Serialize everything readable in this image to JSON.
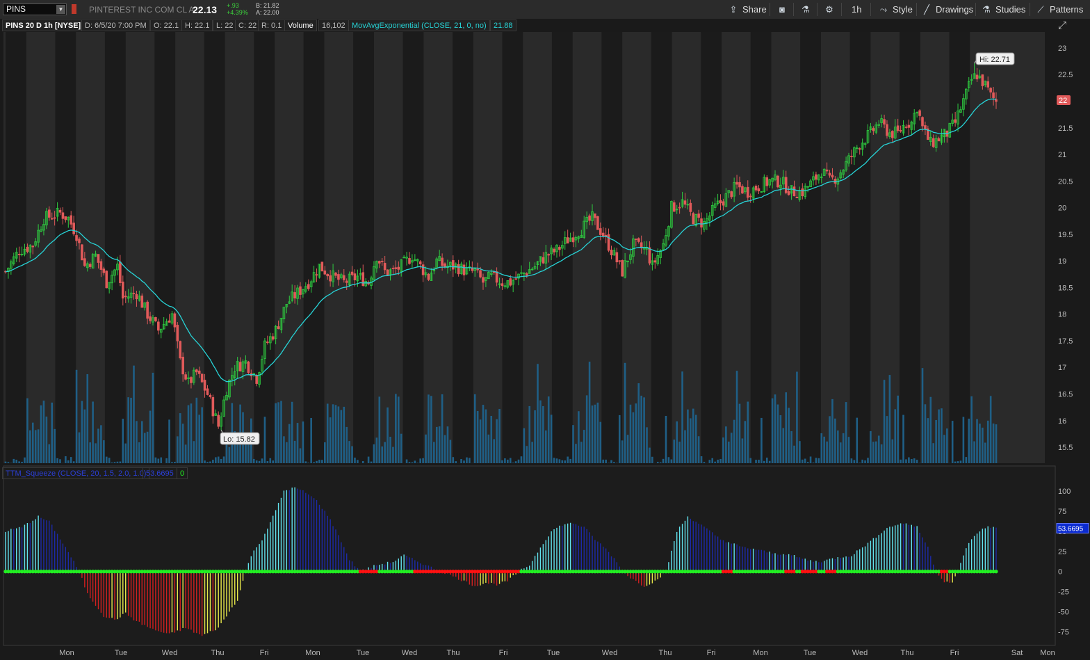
{
  "header": {
    "symbol": "PINS",
    "company": "PINTEREST INC COM CL A",
    "price": "22.13",
    "change": "+.93",
    "change_pct": "+4.39%",
    "bid": "B: 21.82",
    "ask": "A: 22.00",
    "buttons": {
      "share": "Share",
      "interval": "1h",
      "style": "Style",
      "drawings": "Drawings",
      "studies": "Studies",
      "patterns": "Patterns"
    }
  },
  "info": {
    "title": "PINS 20 D 1h [NYSE]",
    "date": "D: 6/5/20 7:00 PM",
    "open": "O: 22.1",
    "high": "H: 22.1",
    "low": "L: 22",
    "close": "C: 22",
    "range": "R: 0.1",
    "volume_label": "Volume",
    "volume_value": "16,102",
    "ma_label": "MovAvgExponential (CLOSE, 21, 0, no)",
    "ma_value": "21.88"
  },
  "indicator": {
    "label": "TTM_Squeeze (CLOSE, 20, 1.5, 2.0, 1.0)",
    "value": "53.6695",
    "state": "0"
  },
  "colors": {
    "up": "#2ecc40",
    "down": "#e15a5a",
    "ema": "#27d3d6",
    "volume": "#1f5f86",
    "hist_pos_rise": "#62e3ee",
    "hist_pos_fall": "#1d2aa8",
    "hist_neg_fall": "#d12020",
    "hist_neg_rise": "#e8e84a",
    "squeeze_on": "#ff1111",
    "squeeze_off": "#22ee22"
  },
  "chart_data": [
    {
      "type": "candlestick",
      "title": "PINS 20 D 1h [NYSE]",
      "xlabel": "",
      "ylabel": "",
      "ylim": [
        15.2,
        23.3
      ],
      "y_ticks": [
        15.5,
        16,
        16.5,
        17,
        17.5,
        18,
        18.5,
        19,
        19.5,
        20,
        20.5,
        21,
        21.5,
        22,
        22.5,
        23
      ],
      "x_day_labels": [
        "Mon",
        "Tue",
        "Wed",
        "Thu",
        "Fri",
        "Mon",
        "Tue",
        "Wed",
        "Thu",
        "Fri",
        "Tue",
        "Wed",
        "Thu",
        "Fri",
        "Mon",
        "Tue",
        "Wed",
        "Thu",
        "Fri",
        "Sat",
        "Mon"
      ],
      "last_price_tag": "22",
      "hi_label": "Hi: 22.71",
      "lo_label": "Lo: 15.82",
      "hi": 22.71,
      "lo": 15.82,
      "price_path": [
        [
          0,
          18.8
        ],
        [
          5,
          19.2
        ],
        [
          10,
          19.3
        ],
        [
          14,
          19.8
        ],
        [
          20,
          19.9
        ],
        [
          23,
          19.8
        ],
        [
          26,
          19.5
        ],
        [
          29,
          18.9
        ],
        [
          33,
          19.1
        ],
        [
          37,
          18.6
        ],
        [
          41,
          18.9
        ],
        [
          43,
          18.3
        ],
        [
          48,
          18.4
        ],
        [
          52,
          18.0
        ],
        [
          56,
          17.7
        ],
        [
          61,
          18.0
        ],
        [
          64,
          17.1
        ],
        [
          67,
          16.7
        ],
        [
          70,
          16.9
        ],
        [
          74,
          16.5
        ],
        [
          78,
          15.9
        ],
        [
          81,
          16.6
        ],
        [
          84,
          17.0
        ],
        [
          88,
          17.1
        ],
        [
          92,
          16.8
        ],
        [
          95,
          17.4
        ],
        [
          99,
          17.7
        ],
        [
          103,
          18.2
        ],
        [
          107,
          18.4
        ],
        [
          111,
          18.6
        ],
        [
          115,
          18.9
        ],
        [
          120,
          18.7
        ],
        [
          124,
          18.6
        ],
        [
          129,
          18.7
        ],
        [
          133,
          18.6
        ],
        [
          136,
          19.1
        ],
        [
          139,
          18.8
        ],
        [
          142,
          18.8
        ],
        [
          145,
          18.9
        ],
        [
          149,
          19.1
        ],
        [
          152,
          18.9
        ],
        [
          155,
          18.7
        ],
        [
          158,
          19.0
        ],
        [
          161,
          18.9
        ],
        [
          165,
          18.9
        ],
        [
          169,
          18.8
        ],
        [
          172,
          18.8
        ],
        [
          175,
          18.6
        ],
        [
          178,
          18.7
        ],
        [
          182,
          18.6
        ],
        [
          185,
          18.6
        ],
        [
          188,
          18.7
        ],
        [
          194,
          18.9
        ],
        [
          198,
          19.1
        ],
        [
          202,
          19.2
        ],
        [
          206,
          19.4
        ],
        [
          211,
          19.6
        ],
        [
          215,
          19.8
        ],
        [
          219,
          19.5
        ],
        [
          222,
          19.2
        ],
        [
          226,
          18.8
        ],
        [
          230,
          19.3
        ],
        [
          235,
          19.2
        ],
        [
          237,
          18.9
        ],
        [
          241,
          19.3
        ],
        [
          244,
          20.0
        ],
        [
          248,
          20.1
        ],
        [
          252,
          19.8
        ],
        [
          256,
          19.7
        ],
        [
          260,
          20.0
        ],
        [
          264,
          20.2
        ],
        [
          268,
          20.4
        ],
        [
          272,
          20.3
        ],
        [
          276,
          20.4
        ],
        [
          280,
          20.5
        ],
        [
          284,
          20.5
        ],
        [
          288,
          20.3
        ],
        [
          292,
          20.3
        ],
        [
          296,
          20.5
        ],
        [
          299,
          20.7
        ],
        [
          302,
          20.5
        ],
        [
          305,
          20.6
        ],
        [
          309,
          20.9
        ],
        [
          313,
          21.2
        ],
        [
          317,
          21.4
        ],
        [
          320,
          21.6
        ],
        [
          324,
          21.4
        ],
        [
          327,
          21.4
        ],
        [
          330,
          21.6
        ],
        [
          332,
          21.6
        ],
        [
          334,
          21.9
        ],
        [
          336,
          21.5
        ],
        [
          339,
          21.2
        ],
        [
          342,
          21.3
        ],
        [
          345,
          21.4
        ],
        [
          348,
          21.6
        ],
        [
          351,
          22.0
        ],
        [
          354,
          22.4
        ],
        [
          356,
          22.5
        ],
        [
          359,
          22.3
        ],
        [
          361,
          22.1
        ],
        [
          363,
          22.0
        ]
      ]
    },
    {
      "type": "histogram",
      "title": "TTM_Squeeze (CLOSE, 20, 1.5, 2.0, 1.0)",
      "ylim": [
        -90,
        112
      ],
      "y_ticks": [
        -75,
        -50,
        -25,
        0,
        25,
        50,
        75,
        100
      ],
      "last_value_tag": "53.6695",
      "momentum_path": [
        [
          0,
          50
        ],
        [
          6,
          55
        ],
        [
          12,
          68
        ],
        [
          16,
          62
        ],
        [
          22,
          30
        ],
        [
          27,
          0
        ],
        [
          30,
          -28
        ],
        [
          36,
          -55
        ],
        [
          40,
          -60
        ],
        [
          44,
          -52
        ],
        [
          48,
          -62
        ],
        [
          54,
          -72
        ],
        [
          60,
          -78
        ],
        [
          66,
          -70
        ],
        [
          72,
          -80
        ],
        [
          78,
          -70
        ],
        [
          85,
          -35
        ],
        [
          88,
          0
        ],
        [
          90,
          20
        ],
        [
          94,
          40
        ],
        [
          98,
          68
        ],
        [
          102,
          100
        ],
        [
          106,
          104
        ],
        [
          110,
          98
        ],
        [
          114,
          88
        ],
        [
          118,
          70
        ],
        [
          122,
          45
        ],
        [
          126,
          15
        ],
        [
          130,
          0
        ],
        [
          136,
          8
        ],
        [
          142,
          12
        ],
        [
          146,
          20
        ],
        [
          150,
          14
        ],
        [
          156,
          5
        ],
        [
          160,
          0
        ],
        [
          168,
          -12
        ],
        [
          172,
          -18
        ],
        [
          176,
          -14
        ],
        [
          180,
          -16
        ],
        [
          184,
          -12
        ],
        [
          188,
          0
        ],
        [
          192,
          8
        ],
        [
          196,
          30
        ],
        [
          200,
          50
        ],
        [
          204,
          58
        ],
        [
          208,
          60
        ],
        [
          212,
          55
        ],
        [
          216,
          40
        ],
        [
          220,
          28
        ],
        [
          224,
          12
        ],
        [
          226,
          0
        ],
        [
          230,
          -10
        ],
        [
          234,
          -18
        ],
        [
          238,
          -12
        ],
        [
          242,
          0
        ],
        [
          246,
          50
        ],
        [
          250,
          68
        ],
        [
          254,
          60
        ],
        [
          258,
          50
        ],
        [
          262,
          40
        ],
        [
          266,
          35
        ],
        [
          270,
          30
        ],
        [
          274,
          28
        ],
        [
          278,
          25
        ],
        [
          282,
          22
        ],
        [
          286,
          22
        ],
        [
          290,
          18
        ],
        [
          294,
          14
        ],
        [
          298,
          12
        ],
        [
          302,
          15
        ],
        [
          306,
          18
        ],
        [
          310,
          20
        ],
        [
          314,
          30
        ],
        [
          318,
          40
        ],
        [
          322,
          52
        ],
        [
          326,
          58
        ],
        [
          330,
          60
        ],
        [
          334,
          55
        ],
        [
          338,
          30
        ],
        [
          341,
          0
        ],
        [
          344,
          -12
        ],
        [
          347,
          -14
        ],
        [
          349,
          0
        ],
        [
          352,
          30
        ],
        [
          356,
          48
        ],
        [
          360,
          56
        ],
        [
          363,
          54
        ]
      ],
      "squeeze_on_ranges": [
        [
          130,
          136
        ],
        [
          150,
          188
        ],
        [
          263,
          266
        ],
        [
          286,
          289
        ],
        [
          292,
          297
        ],
        [
          301,
          304
        ],
        [
          343,
          345
        ]
      ]
    }
  ]
}
